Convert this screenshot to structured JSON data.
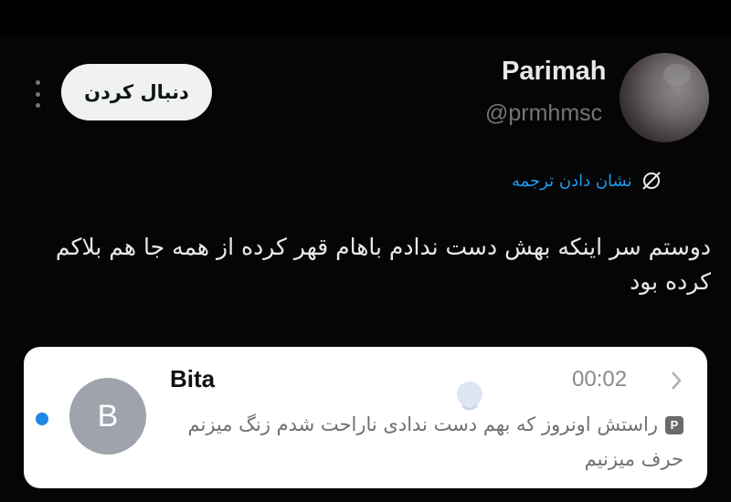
{
  "tweet": {
    "author_name": "Parimah",
    "author_handle": "@prmhmsc",
    "follow_label": "دنبال کردن",
    "translate_label": "نشان دادن ترجمه",
    "text": "دوستم سر اینکه بهش دست ندادم باهام قهر کرده از همه جا هم بلاکم کرده بود"
  },
  "chat_card": {
    "avatar_letter": "B",
    "contact_name": "Bita",
    "time": "00:02",
    "badge": "P",
    "message": "راستش اونروز که بهم دست ندادی ناراحت شدم زنگ میزنم حرف میزنیم",
    "unread_color": "#1e88e5"
  },
  "colors": {
    "background": "#050505",
    "accent": "#1d9bf0",
    "follow_button_bg": "#f0f2f1"
  },
  "icons": {
    "more": "more-vertical-icon",
    "translate": "translate-globe-icon",
    "chevron": "chevron-right-icon"
  }
}
